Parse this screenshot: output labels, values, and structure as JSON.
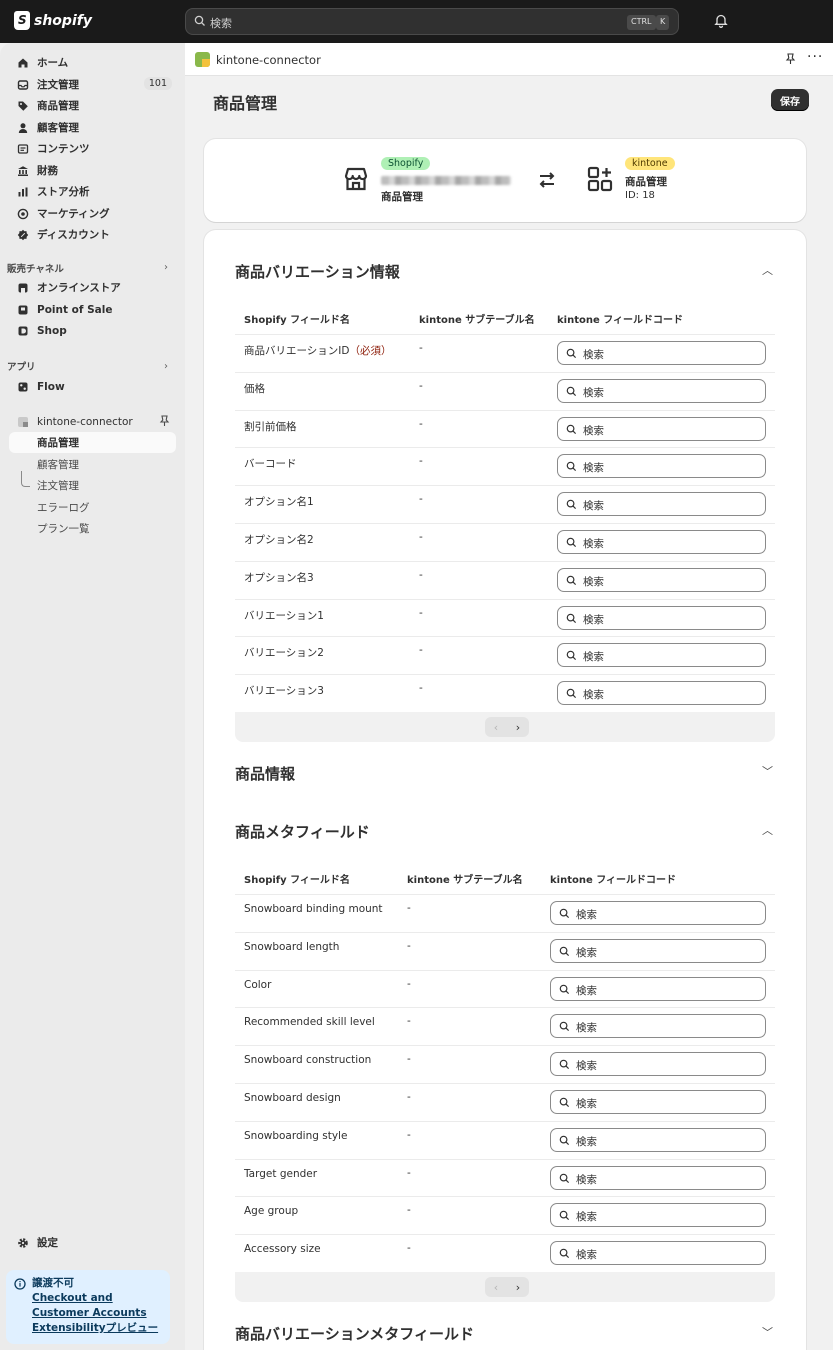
{
  "topbar": {
    "logo_text": "shopify",
    "search_placeholder": "検索",
    "shortcut_1": "CTRL",
    "shortcut_2": "K"
  },
  "sidebar": {
    "items": [
      {
        "label": "ホーム",
        "icon": "home-icon"
      },
      {
        "label": "注文管理",
        "icon": "inbox-icon",
        "badge": "101"
      },
      {
        "label": "商品管理",
        "icon": "tag-icon"
      },
      {
        "label": "顧客管理",
        "icon": "person-icon"
      },
      {
        "label": "コンテンツ",
        "icon": "content-icon"
      },
      {
        "label": "財務",
        "icon": "bank-icon"
      },
      {
        "label": "ストア分析",
        "icon": "chart-icon"
      },
      {
        "label": "マーケティング",
        "icon": "target-icon"
      },
      {
        "label": "ディスカウント",
        "icon": "discount-icon"
      }
    ],
    "sales_channels_heading": "販売チャネル",
    "sales_channels": [
      {
        "label": "オンラインストア",
        "icon": "store-icon"
      },
      {
        "label": "Point of Sale",
        "icon": "pos-icon"
      },
      {
        "label": "Shop",
        "icon": "shop-icon"
      }
    ],
    "apps_heading": "アプリ",
    "apps": [
      {
        "label": "Flow",
        "icon": "flow-icon"
      },
      {
        "label": "kintone-connector",
        "icon": "app-icon"
      }
    ],
    "app_subitems": [
      "商品管理",
      "顧客管理",
      "注文管理",
      "エラーログ",
      "プラン一覧"
    ],
    "settings_label": "設定",
    "notice": {
      "title": "譲渡不可",
      "link": "Checkout and Customer Accounts Extensibilityプレビュー"
    }
  },
  "app_header": {
    "name": "kintone-connector"
  },
  "page": {
    "title": "商品管理",
    "save_label": "保存"
  },
  "connection": {
    "left_pill": "Shopify",
    "left_label": "商品管理",
    "right_pill": "kintone",
    "right_title": "商品管理",
    "right_id": "ID: 18"
  },
  "variation_section": {
    "title": "商品バリエーション情報",
    "headers": [
      "Shopify フィールド名",
      "kintone サブテーブル名",
      "kintone フィールドコード"
    ],
    "rows": [
      {
        "name": "商品バリエーションID",
        "required": "（必須）",
        "sub": "-",
        "placeholder": "検索"
      },
      {
        "name": "価格",
        "required": "",
        "sub": "-",
        "placeholder": "検索"
      },
      {
        "name": "割引前価格",
        "required": "",
        "sub": "-",
        "placeholder": "検索"
      },
      {
        "name": "バーコード",
        "required": "",
        "sub": "-",
        "placeholder": "検索"
      },
      {
        "name": "オプション名1",
        "required": "",
        "sub": "-",
        "placeholder": "検索"
      },
      {
        "name": "オプション名2",
        "required": "",
        "sub": "-",
        "placeholder": "検索"
      },
      {
        "name": "オプション名3",
        "required": "",
        "sub": "-",
        "placeholder": "検索"
      },
      {
        "name": "バリエーション1",
        "required": "",
        "sub": "-",
        "placeholder": "検索"
      },
      {
        "name": "バリエーション2",
        "required": "",
        "sub": "-",
        "placeholder": "検索"
      },
      {
        "name": "バリエーション3",
        "required": "",
        "sub": "-",
        "placeholder": "検索"
      }
    ]
  },
  "product_info_section": {
    "title": "商品情報"
  },
  "metafield_section": {
    "title": "商品メタフィールド",
    "headers": [
      "Shopify フィールド名",
      "kintone サブテーブル名",
      "kintone フィールドコード"
    ],
    "rows": [
      {
        "name": "Snowboard binding mount",
        "sub": "-",
        "placeholder": "検索"
      },
      {
        "name": "Snowboard length",
        "sub": "-",
        "placeholder": "検索"
      },
      {
        "name": "Color",
        "sub": "-",
        "placeholder": "検索"
      },
      {
        "name": "Recommended skill level",
        "sub": "-",
        "placeholder": "検索"
      },
      {
        "name": "Snowboard construction",
        "sub": "-",
        "placeholder": "検索"
      },
      {
        "name": "Snowboard design",
        "sub": "-",
        "placeholder": "検索"
      },
      {
        "name": "Snowboarding style",
        "sub": "-",
        "placeholder": "検索"
      },
      {
        "name": "Target gender",
        "sub": "-",
        "placeholder": "検索"
      },
      {
        "name": "Age group",
        "sub": "-",
        "placeholder": "検索"
      },
      {
        "name": "Accessory size",
        "sub": "-",
        "placeholder": "検索"
      }
    ]
  },
  "variation_metafield_section": {
    "title": "商品バリエーションメタフィールド"
  },
  "colors": {
    "topbar": "#1a1a1a",
    "required": "#8e1f0b",
    "pill_green": "#aff0b5",
    "pill_yellow": "#ffe57a"
  }
}
